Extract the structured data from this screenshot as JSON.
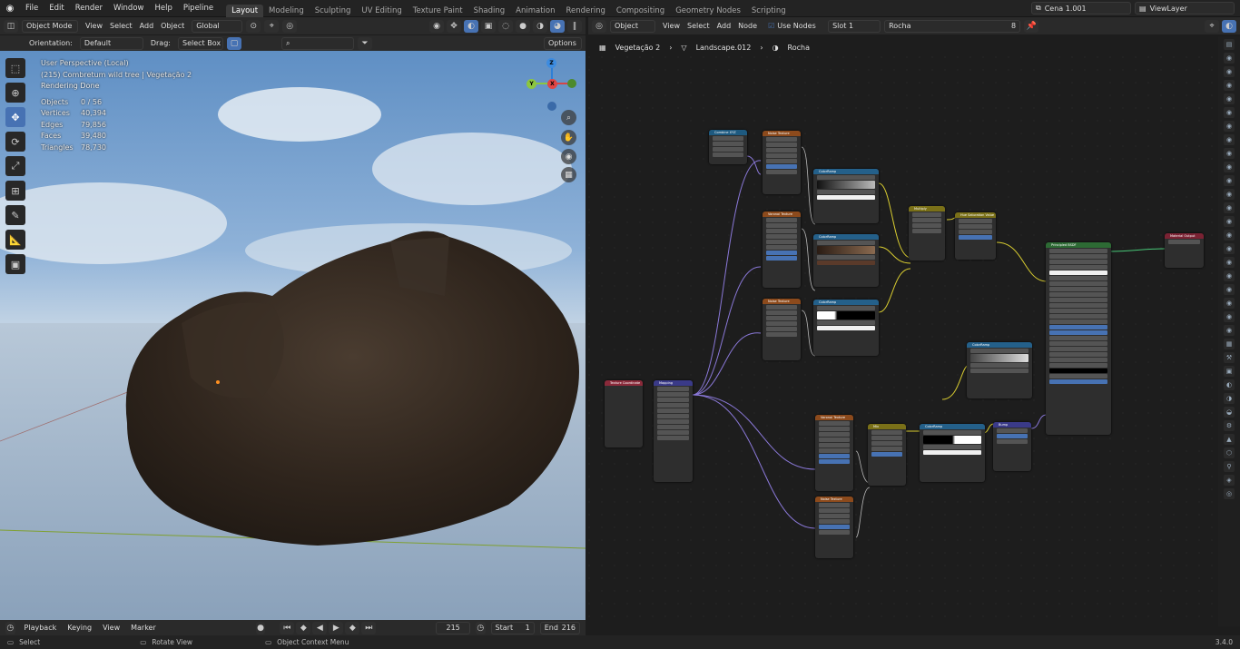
{
  "topbar": {
    "menus": [
      "File",
      "Edit",
      "Render",
      "Window",
      "Help",
      "Pipeline"
    ],
    "workspaces": [
      "Layout",
      "Modeling",
      "Sculpting",
      "UV Editing",
      "Texture Paint",
      "Shading",
      "Animation",
      "Rendering",
      "Compositing",
      "Geometry Nodes",
      "Scripting"
    ],
    "active_workspace": "Layout",
    "scene": "Cena 1.001",
    "view_layer": "ViewLayer"
  },
  "viewport_header": {
    "mode": "Object Mode",
    "menus": [
      "View",
      "Select",
      "Add",
      "Object"
    ],
    "transform_orientation": "Global"
  },
  "viewport_tool_settings": {
    "orientation_label": "Orientation:",
    "orientation_value": "Default",
    "drag_label": "Drag:",
    "drag_value": "Select Box",
    "options": "Options"
  },
  "viewport_info": {
    "perspective": "User Perspective (Local)",
    "object": "(215) Combretum wild tree | Vegetação 2",
    "rendering": "Rendering Done",
    "stats": [
      {
        "k": "Objects",
        "v": "0 / 56"
      },
      {
        "k": "Vertices",
        "v": "40,394"
      },
      {
        "k": "Edges",
        "v": "79,856"
      },
      {
        "k": "Faces",
        "v": "39,480"
      },
      {
        "k": "Triangles",
        "v": "78,730"
      }
    ]
  },
  "gizmo": {
    "z": "Z",
    "y": "Y",
    "x": "X"
  },
  "node_header": {
    "editor_type": "Object",
    "menus": [
      "View",
      "Select",
      "Add",
      "Node"
    ],
    "use_nodes": "Use Nodes",
    "slot": "Slot 1",
    "material": "Rocha",
    "users": "8"
  },
  "breadcrumb": [
    "Vegetação 2",
    "Landscape.012",
    "Rocha"
  ],
  "timeline": {
    "menus": [
      "Playback",
      "Keying",
      "View",
      "Marker"
    ],
    "current_frame": "215",
    "start_label": "Start",
    "start": "1",
    "end_label": "End",
    "end": "216"
  },
  "statusbar": {
    "select": "Select",
    "rotate": "Rotate View",
    "context": "Object Context Menu",
    "version": "3.4.0"
  },
  "nodes": [
    {
      "id": "combine-xyz",
      "title": "Combine XYZ",
      "color": "#1e5a80"
    },
    {
      "id": "noise-texture-1",
      "title": "Noise Texture",
      "color": "#8c4a1c"
    },
    {
      "id": "color-ramp-1",
      "title": "ColorRamp",
      "color": "#24608a"
    },
    {
      "id": "voronoi-texture-1",
      "title": "Voronoi Texture",
      "color": "#8c4a1c"
    },
    {
      "id": "color-ramp-2",
      "title": "ColorRamp",
      "color": "#24608a"
    },
    {
      "id": "noise-texture-2",
      "title": "Noise Texture",
      "color": "#8c4a1c"
    },
    {
      "id": "color-ramp-3",
      "title": "ColorRamp",
      "color": "#24608a"
    },
    {
      "id": "mix-1",
      "title": "Multiply",
      "color": "#7a7018"
    },
    {
      "id": "hue-saturation",
      "title": "Hue Saturation Value",
      "color": "#7a7018"
    },
    {
      "id": "principled-bsdf",
      "title": "Principled BSDF",
      "color": "#2d6a34"
    },
    {
      "id": "material-output",
      "title": "Material Output",
      "color": "#7a2233"
    },
    {
      "id": "texture-coordinate",
      "title": "Texture Coordinate",
      "color": "#8a2a3a"
    },
    {
      "id": "mapping",
      "title": "Mapping",
      "color": "#3a3a88"
    },
    {
      "id": "color-ramp-4",
      "title": "ColorRamp",
      "color": "#24608a"
    },
    {
      "id": "voronoi-texture-2",
      "title": "Voronoi Texture",
      "color": "#8c4a1c"
    },
    {
      "id": "mix-2",
      "title": "Mix",
      "color": "#7a7018"
    },
    {
      "id": "color-ramp-5",
      "title": "ColorRamp",
      "color": "#24608a"
    },
    {
      "id": "bump",
      "title": "Bump",
      "color": "#3a3a88"
    },
    {
      "id": "noise-texture-3",
      "title": "Noise Texture",
      "color": "#8c4a1c"
    }
  ]
}
